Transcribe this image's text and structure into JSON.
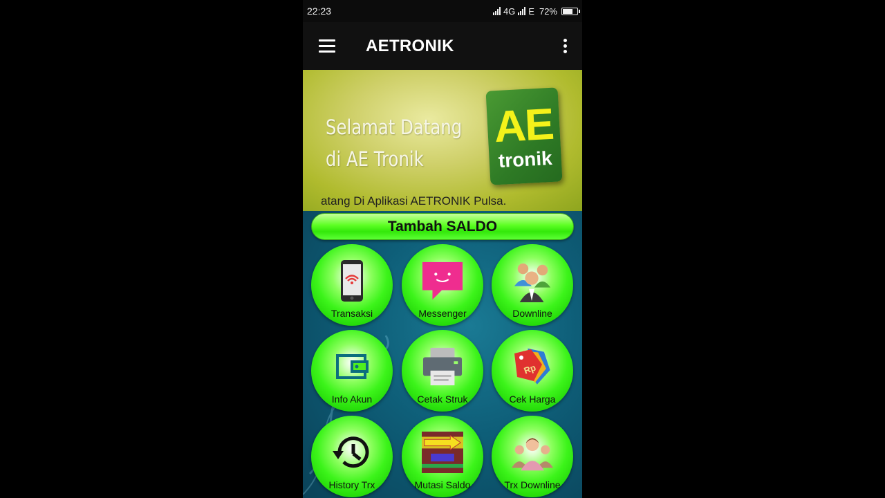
{
  "status_bar": {
    "time": "22:23",
    "network_1": "4G",
    "network_2": "E",
    "battery_text": "72%",
    "battery_level": 0.72
  },
  "toolbar": {
    "menu_icon": "hamburger-menu-icon",
    "title": "AETRONIK",
    "overflow_icon": "more-vertical-icon"
  },
  "banner": {
    "line_1": "Selamat Datang",
    "line_2": "di AE Tronik",
    "logo_top": "AE",
    "logo_bottom": "tronik",
    "marquee": "atang Di Aplikasi AETRONIK Pulsa."
  },
  "saldo_button": "Tambah SALDO",
  "menu": {
    "items": [
      {
        "label": "Transaksi",
        "icon": "smartphone-wifi-icon"
      },
      {
        "label": "Messenger",
        "icon": "chat-bubble-icon"
      },
      {
        "label": "Downline",
        "icon": "people-group-icon"
      },
      {
        "label": "Info Akun",
        "icon": "wallet-icon"
      },
      {
        "label": "Cetak Struk",
        "icon": "printer-icon"
      },
      {
        "label": "Cek Harga",
        "icon": "price-tag-icon"
      },
      {
        "label": "History Trx",
        "icon": "history-clock-icon"
      },
      {
        "label": "Mutasi Saldo",
        "icon": "transfer-arrow-icon"
      },
      {
        "label": "Trx Downline",
        "icon": "team-icon"
      }
    ]
  },
  "colors": {
    "toolbar": "#111111",
    "tile_green": "#3cf41a",
    "content_bg": "#0e5e78",
    "logo_yellow": "#f4f21a"
  }
}
